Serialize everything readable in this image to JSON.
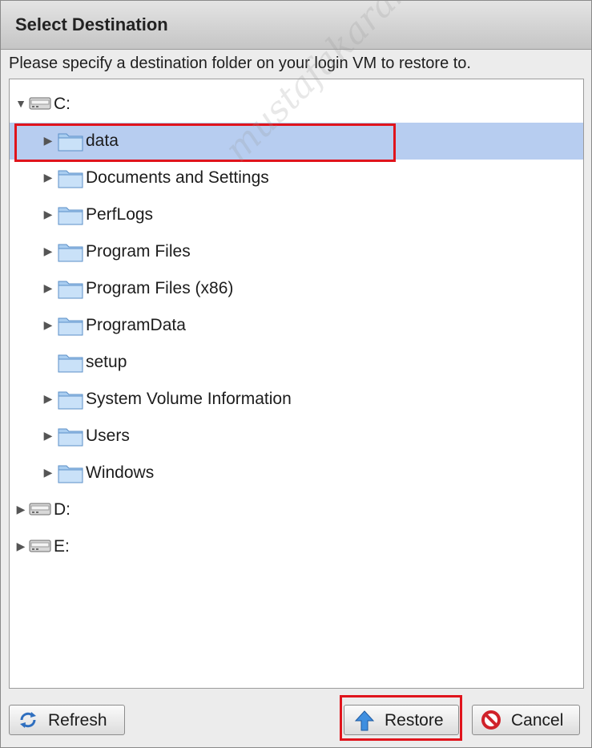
{
  "dialog": {
    "title": "Select Destination",
    "instruction": "Please specify a destination folder on your login VM to restore to."
  },
  "tree": {
    "nodes": [
      {
        "label": "C:",
        "type": "drive",
        "expanded": true,
        "depth": 0
      },
      {
        "label": "data",
        "type": "folder",
        "expandable": true,
        "depth": 1,
        "selected": true
      },
      {
        "label": "Documents and Settings",
        "type": "folder",
        "expandable": true,
        "depth": 1
      },
      {
        "label": "PerfLogs",
        "type": "folder",
        "expandable": true,
        "depth": 1
      },
      {
        "label": "Program Files",
        "type": "folder",
        "expandable": true,
        "depth": 1
      },
      {
        "label": "Program Files (x86)",
        "type": "folder",
        "expandable": true,
        "depth": 1
      },
      {
        "label": "ProgramData",
        "type": "folder",
        "expandable": true,
        "depth": 1
      },
      {
        "label": "setup",
        "type": "folder",
        "expandable": false,
        "depth": 1
      },
      {
        "label": "System Volume Information",
        "type": "folder",
        "expandable": true,
        "depth": 1
      },
      {
        "label": "Users",
        "type": "folder",
        "expandable": true,
        "depth": 1
      },
      {
        "label": "Windows",
        "type": "folder",
        "expandable": true,
        "depth": 1
      },
      {
        "label": "D:",
        "type": "drive",
        "expanded": false,
        "depth": 0
      },
      {
        "label": "E:",
        "type": "drive",
        "expanded": false,
        "depth": 0
      }
    ]
  },
  "buttons": {
    "refresh": "Refresh",
    "restore": "Restore",
    "cancel": "Cancel"
  },
  "icons": {
    "folder": "folder-icon",
    "drive": "drive-icon",
    "refresh": "refresh-icon",
    "restore": "restore-arrow-icon",
    "cancel": "cancel-icon"
  },
  "colors": {
    "selection": "#b7cdf0",
    "highlight": "#e0141c"
  },
  "watermark": "mustafakarakoyun.com"
}
